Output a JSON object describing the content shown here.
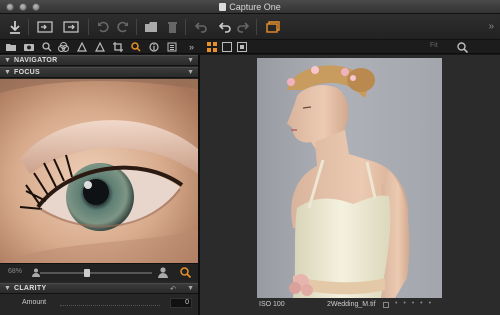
{
  "window": {
    "title": "Capture One"
  },
  "toolbar": {
    "buttons": [
      "import-icon",
      "browse-icon",
      "export-icon",
      "rotate-left-icon",
      "rotate-right-icon",
      "new-folder-icon",
      "trash-icon",
      "undo-icon",
      "undo-icon",
      "redo-icon",
      "window-icon"
    ],
    "accent": "#e8912a"
  },
  "tooltabs": {
    "fit_label": "Fit"
  },
  "panels": {
    "navigator": {
      "label": "NAVIGATOR"
    },
    "focus": {
      "label": "FOCUS",
      "zoom": "68%"
    },
    "clarity": {
      "label": "CLARITY",
      "amount_label": "Amount",
      "amount_value": "0"
    }
  },
  "viewer": {
    "iso": "ISO 100",
    "filename": "2Wedding_M.tif",
    "dots": "• • • • •"
  }
}
